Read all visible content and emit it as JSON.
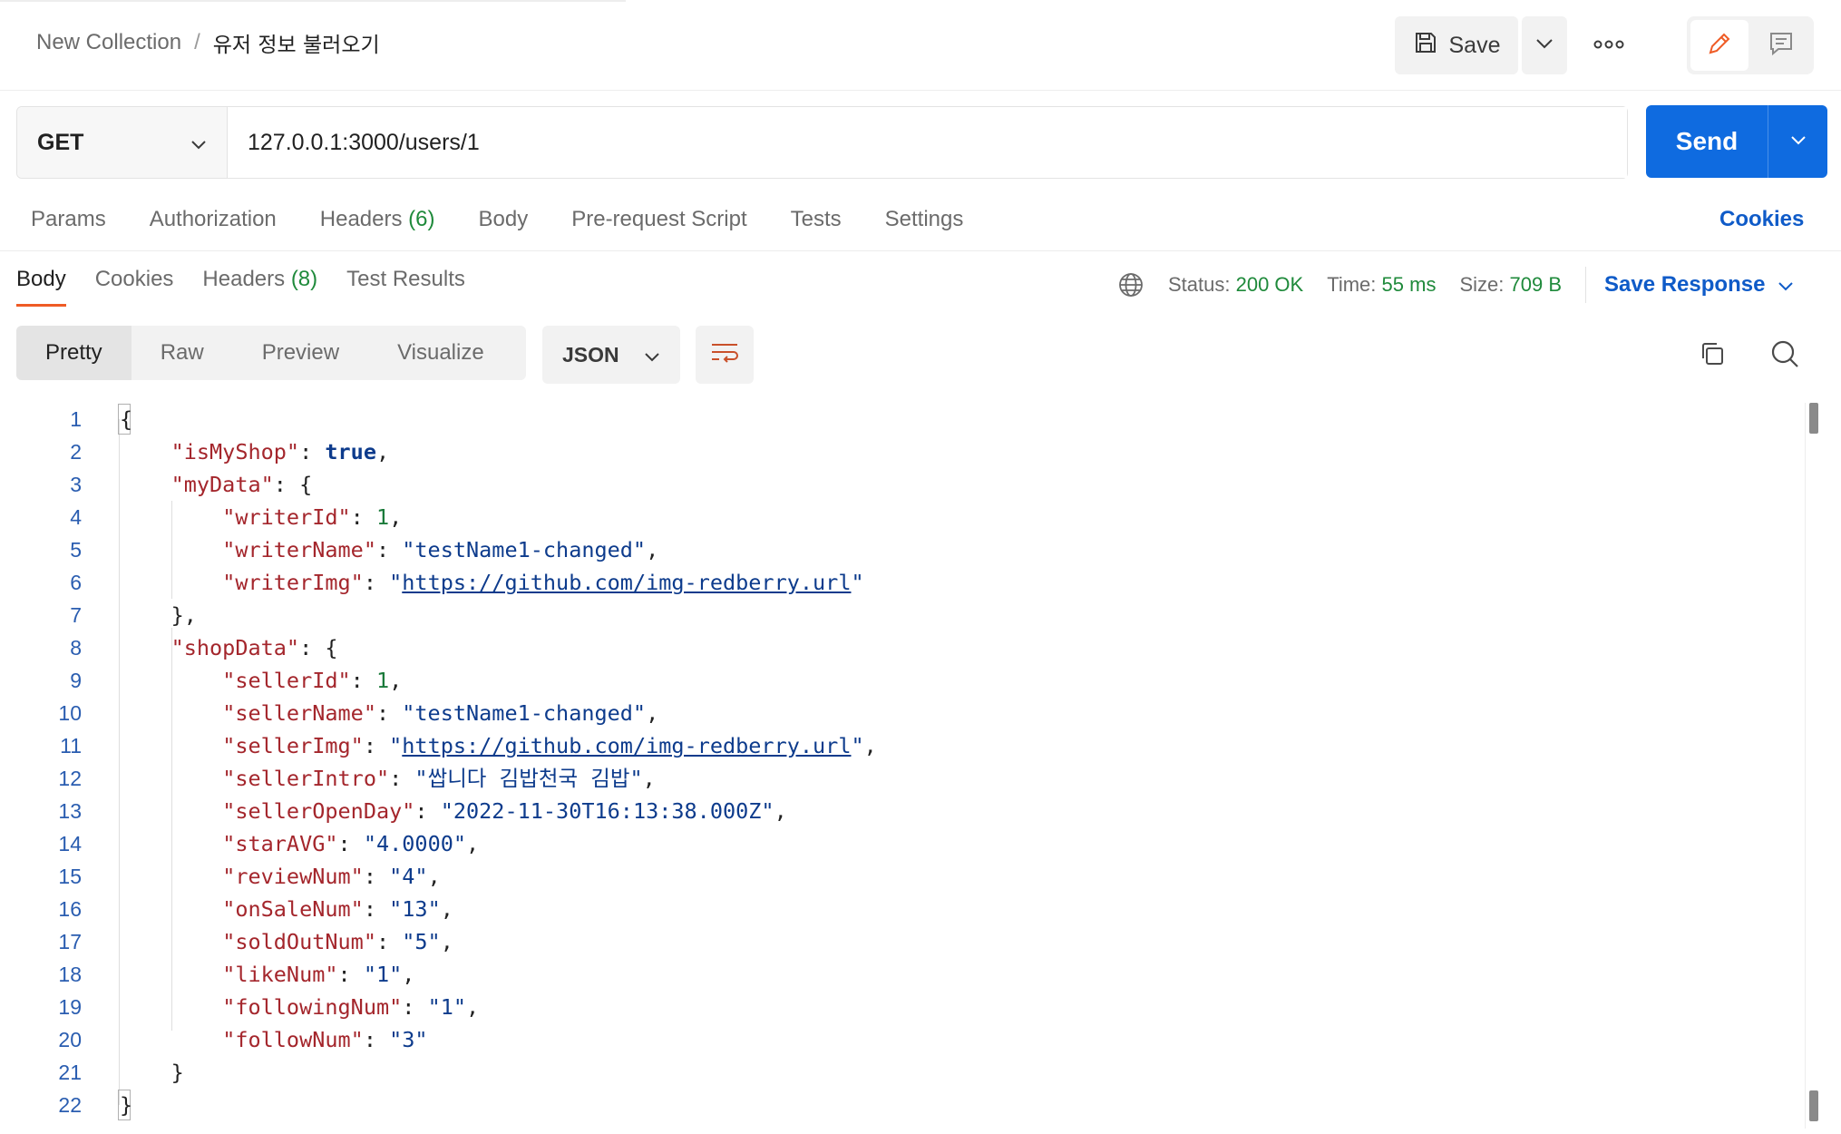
{
  "header": {
    "collection": "New Collection",
    "separator": "/",
    "request_name": "유저 정보 불러오기",
    "save_label": "Save",
    "icons": {
      "save": "floppy-icon",
      "caret": "chevron-down-icon",
      "more": "more-horizontal-icon",
      "edit": "pencil-icon",
      "comment": "comment-icon"
    },
    "accent": "#ef5b25"
  },
  "request": {
    "method": "GET",
    "url": "127.0.0.1:3000/users/1",
    "send_label": "Send",
    "send_color": "#0f6be0",
    "tabs": [
      {
        "label": "Params",
        "count": ""
      },
      {
        "label": "Authorization",
        "count": ""
      },
      {
        "label": "Headers",
        "count": "(6)"
      },
      {
        "label": "Body",
        "count": ""
      },
      {
        "label": "Pre-request Script",
        "count": ""
      },
      {
        "label": "Tests",
        "count": ""
      },
      {
        "label": "Settings",
        "count": ""
      }
    ],
    "cookies_label": "Cookies"
  },
  "response": {
    "tabs": [
      {
        "label": "Body",
        "count": ""
      },
      {
        "label": "Cookies",
        "count": ""
      },
      {
        "label": "Headers",
        "count": "(8)"
      },
      {
        "label": "Test Results",
        "count": ""
      }
    ],
    "status_label": "Status:",
    "status_value": "200 OK",
    "time_label": "Time:",
    "time_value": "55 ms",
    "size_label": "Size:",
    "size_value": "709 B",
    "save_response_label": "Save Response",
    "views": [
      "Pretty",
      "Raw",
      "Preview",
      "Visualize"
    ],
    "format": "JSON",
    "icons": {
      "globe": "globe-icon",
      "wrap": "wrap-lines-icon",
      "copy": "copy-icon",
      "search": "search-icon"
    }
  },
  "code_lines": [
    {
      "n": "1",
      "t": [
        [
          "p",
          "{"
        ]
      ]
    },
    {
      "n": "2",
      "t": [
        [
          "p",
          "    "
        ],
        [
          "k",
          "\"isMyShop\""
        ],
        [
          "p",
          ": "
        ],
        [
          "b",
          "true"
        ],
        [
          "p",
          ","
        ]
      ]
    },
    {
      "n": "3",
      "t": [
        [
          "p",
          "    "
        ],
        [
          "k",
          "\"myData\""
        ],
        [
          "p",
          ": {"
        ]
      ]
    },
    {
      "n": "4",
      "t": [
        [
          "p",
          "        "
        ],
        [
          "k",
          "\"writerId\""
        ],
        [
          "p",
          ": "
        ],
        [
          "n",
          "1"
        ],
        [
          "p",
          ","
        ]
      ]
    },
    {
      "n": "5",
      "t": [
        [
          "p",
          "        "
        ],
        [
          "k",
          "\"writerName\""
        ],
        [
          "p",
          ": "
        ],
        [
          "s",
          "\"testName1-changed\""
        ],
        [
          "p",
          ","
        ]
      ]
    },
    {
      "n": "6",
      "t": [
        [
          "p",
          "        "
        ],
        [
          "k",
          "\"writerImg\""
        ],
        [
          "p",
          ": "
        ],
        [
          "s",
          "\""
        ],
        [
          "u",
          "https://github.com/img-redberry.url"
        ],
        [
          "s",
          "\""
        ]
      ]
    },
    {
      "n": "7",
      "t": [
        [
          "p",
          "    },"
        ]
      ]
    },
    {
      "n": "8",
      "t": [
        [
          "p",
          "    "
        ],
        [
          "k",
          "\"shopData\""
        ],
        [
          "p",
          ": {"
        ]
      ]
    },
    {
      "n": "9",
      "t": [
        [
          "p",
          "        "
        ],
        [
          "k",
          "\"sellerId\""
        ],
        [
          "p",
          ": "
        ],
        [
          "n",
          "1"
        ],
        [
          "p",
          ","
        ]
      ]
    },
    {
      "n": "10",
      "t": [
        [
          "p",
          "        "
        ],
        [
          "k",
          "\"sellerName\""
        ],
        [
          "p",
          ": "
        ],
        [
          "s",
          "\"testName1-changed\""
        ],
        [
          "p",
          ","
        ]
      ]
    },
    {
      "n": "11",
      "t": [
        [
          "p",
          "        "
        ],
        [
          "k",
          "\"sellerImg\""
        ],
        [
          "p",
          ": "
        ],
        [
          "s",
          "\""
        ],
        [
          "u",
          "https://github.com/img-redberry.url"
        ],
        [
          "s",
          "\""
        ],
        [
          "p",
          ","
        ]
      ]
    },
    {
      "n": "12",
      "t": [
        [
          "p",
          "        "
        ],
        [
          "k",
          "\"sellerIntro\""
        ],
        [
          "p",
          ": "
        ],
        [
          "s",
          "\"쌉니다 김밥천국 김밥\""
        ],
        [
          "p",
          ","
        ]
      ]
    },
    {
      "n": "13",
      "t": [
        [
          "p",
          "        "
        ],
        [
          "k",
          "\"sellerOpenDay\""
        ],
        [
          "p",
          ": "
        ],
        [
          "s",
          "\"2022-11-30T16:13:38.000Z\""
        ],
        [
          "p",
          ","
        ]
      ]
    },
    {
      "n": "14",
      "t": [
        [
          "p",
          "        "
        ],
        [
          "k",
          "\"starAVG\""
        ],
        [
          "p",
          ": "
        ],
        [
          "s",
          "\"4.0000\""
        ],
        [
          "p",
          ","
        ]
      ]
    },
    {
      "n": "15",
      "t": [
        [
          "p",
          "        "
        ],
        [
          "k",
          "\"reviewNum\""
        ],
        [
          "p",
          ": "
        ],
        [
          "s",
          "\"4\""
        ],
        [
          "p",
          ","
        ]
      ]
    },
    {
      "n": "16",
      "t": [
        [
          "p",
          "        "
        ],
        [
          "k",
          "\"onSaleNum\""
        ],
        [
          "p",
          ": "
        ],
        [
          "s",
          "\"13\""
        ],
        [
          "p",
          ","
        ]
      ]
    },
    {
      "n": "17",
      "t": [
        [
          "p",
          "        "
        ],
        [
          "k",
          "\"soldOutNum\""
        ],
        [
          "p",
          ": "
        ],
        [
          "s",
          "\"5\""
        ],
        [
          "p",
          ","
        ]
      ]
    },
    {
      "n": "18",
      "t": [
        [
          "p",
          "        "
        ],
        [
          "k",
          "\"likeNum\""
        ],
        [
          "p",
          ": "
        ],
        [
          "s",
          "\"1\""
        ],
        [
          "p",
          ","
        ]
      ]
    },
    {
      "n": "19",
      "t": [
        [
          "p",
          "        "
        ],
        [
          "k",
          "\"followingNum\""
        ],
        [
          "p",
          ": "
        ],
        [
          "s",
          "\"1\""
        ],
        [
          "p",
          ","
        ]
      ]
    },
    {
      "n": "20",
      "t": [
        [
          "p",
          "        "
        ],
        [
          "k",
          "\"followNum\""
        ],
        [
          "p",
          ": "
        ],
        [
          "s",
          "\"3\""
        ]
      ]
    },
    {
      "n": "21",
      "t": [
        [
          "p",
          "    }"
        ]
      ]
    },
    {
      "n": "22",
      "t": [
        [
          "p",
          "}"
        ]
      ]
    }
  ]
}
